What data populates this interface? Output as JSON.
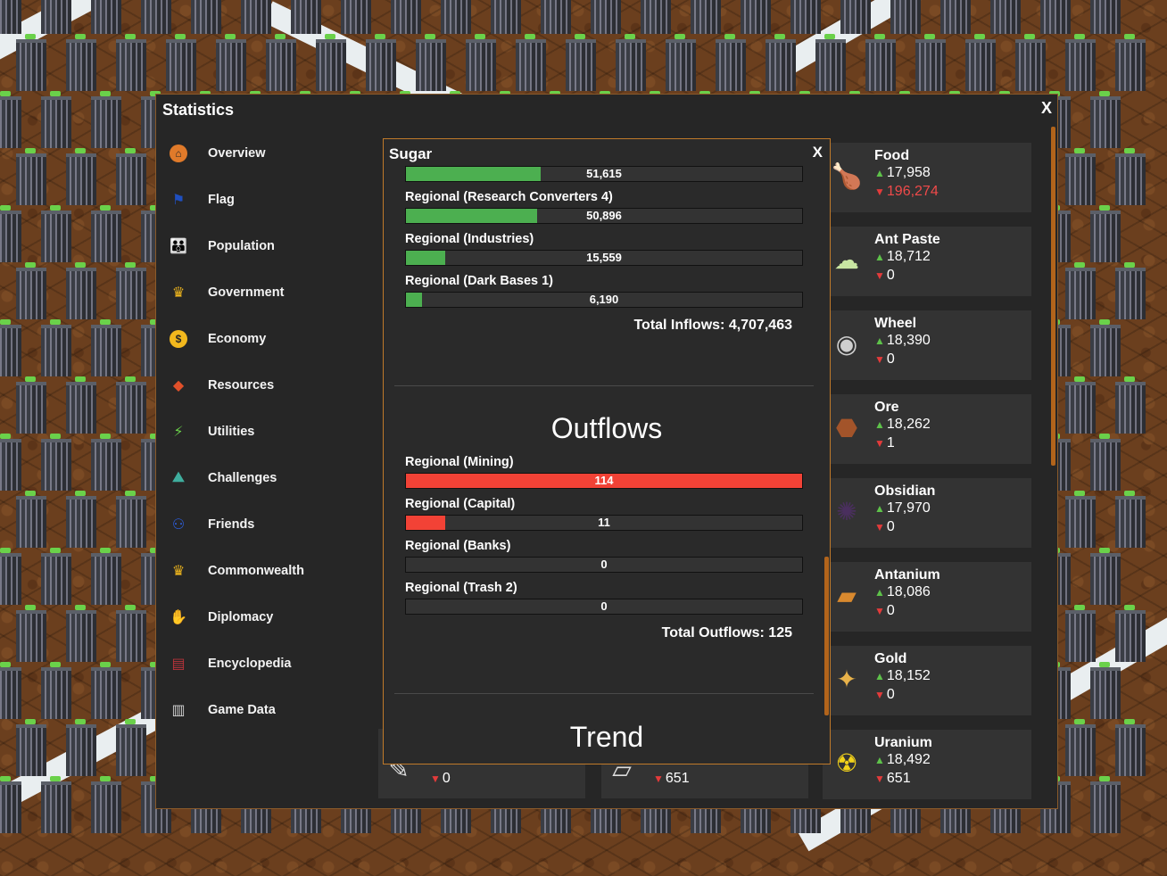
{
  "stats": {
    "title": "Statistics",
    "close_label": "X",
    "nav": [
      {
        "label": "Overview",
        "icon": "house-icon",
        "color": "#e07a2a"
      },
      {
        "label": "Flag",
        "icon": "flag-icon",
        "color": "#1f4fbf"
      },
      {
        "label": "Population",
        "icon": "people-icon",
        "color": "#f4d9b3"
      },
      {
        "label": "Government",
        "icon": "crown-icon",
        "color": "#f2b81d"
      },
      {
        "label": "Economy",
        "icon": "dollar-icon",
        "color": "#f2b81d"
      },
      {
        "label": "Resources",
        "icon": "resources-icon",
        "color": "#e0502a"
      },
      {
        "label": "Utilities",
        "icon": "utilities-icon",
        "color": "#6ad14a"
      },
      {
        "label": "Challenges",
        "icon": "mountain-flag-icon",
        "color": "#3fae9e"
      },
      {
        "label": "Friends",
        "icon": "friends-icon",
        "color": "#2d5fe0"
      },
      {
        "label": "Commonwealth",
        "icon": "crown-icon",
        "color": "#f2b81d"
      },
      {
        "label": "Diplomacy",
        "icon": "handshake-icon",
        "color": "#2aa9d8"
      },
      {
        "label": "Encyclopedia",
        "icon": "books-icon",
        "color": "#b8333a"
      },
      {
        "label": "Game Data",
        "icon": "database-icon",
        "color": "#cfcfcf"
      }
    ]
  },
  "cards": [
    {
      "name": "Food",
      "up": "17,958",
      "down": "196,274",
      "down_negative": true,
      "icon": "drumstick-icon",
      "glyph": "🍗"
    },
    {
      "name": "Ant Paste",
      "up": "18,712",
      "down": "0",
      "down_negative": false,
      "icon": "paste-icon",
      "glyph": "☁"
    },
    {
      "name": "Wheel",
      "up": "18,390",
      "down": "0",
      "down_negative": false,
      "icon": "wheel-icon",
      "glyph": "◉"
    },
    {
      "name": "Ore",
      "up": "18,262",
      "down": "1",
      "down_negative": false,
      "icon": "ore-icon",
      "glyph": "⬣"
    },
    {
      "name": "Obsidian",
      "up": "17,970",
      "down": "0",
      "down_negative": false,
      "icon": "obsidian-icon",
      "glyph": "✺"
    },
    {
      "name": "Antanium",
      "up": "18,086",
      "down": "0",
      "down_negative": false,
      "icon": "ingot-icon",
      "glyph": "▰"
    },
    {
      "name": "Gold",
      "up": "18,152",
      "down": "0",
      "down_negative": false,
      "icon": "gold-nugget-icon",
      "glyph": "✦"
    },
    {
      "name": "Uranium",
      "up": "18,492",
      "down": "651",
      "down_negative": false,
      "icon": "radiation-icon",
      "glyph": "☢"
    }
  ],
  "bottom_cards": [
    {
      "down": "0",
      "icon": "feather-icon"
    },
    {
      "down": "651",
      "icon": "paper-icon"
    }
  ],
  "popup": {
    "title": "Sugar",
    "close_label": "X",
    "inflows": [
      {
        "label": "",
        "value": "51,615",
        "fraction": 0.34
      },
      {
        "label": "Regional (Research Converters 4)",
        "value": "50,896",
        "fraction": 0.33
      },
      {
        "label": "Regional (Industries)",
        "value": "15,559",
        "fraction": 0.1
      },
      {
        "label": "Regional (Dark Bases 1)",
        "value": "6,190",
        "fraction": 0.04
      }
    ],
    "total_inflows": "Total Inflows: 4,707,463",
    "outflows_title": "Outflows",
    "outflows": [
      {
        "label": "Regional (Mining)",
        "value": "114",
        "fraction": 1.0
      },
      {
        "label": "Regional (Capital)",
        "value": "11",
        "fraction": 0.1
      },
      {
        "label": "Regional (Banks)",
        "value": "0",
        "fraction": 0
      },
      {
        "label": "Regional (Trash 2)",
        "value": "0",
        "fraction": 0
      }
    ],
    "total_outflows": "Total Outflows: 125",
    "trend_title": "Trend"
  },
  "colors": {
    "inflow_bar": "#4caf50",
    "outflow_bar": "#f24236",
    "up_arrow": "#5ec24a",
    "down_arrow": "#e33b3b",
    "accent": "#b2641b"
  }
}
